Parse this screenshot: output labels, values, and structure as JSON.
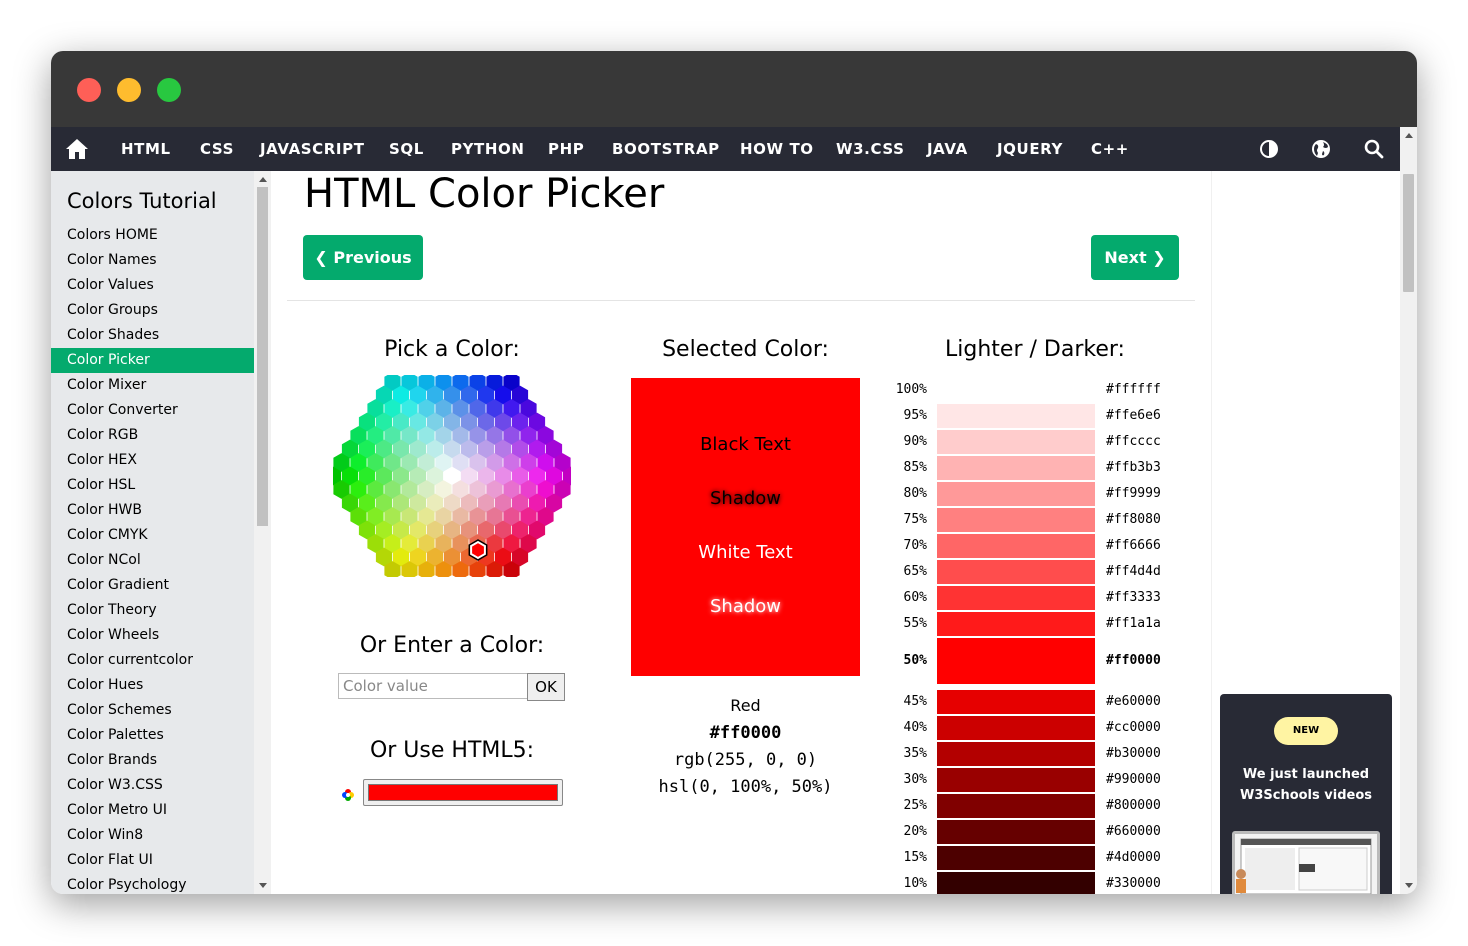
{
  "nav": {
    "items": [
      "HTML",
      "CSS",
      "JAVASCRIPT",
      "SQL",
      "PYTHON",
      "PHP",
      "BOOTSTRAP",
      "HOW TO",
      "W3.CSS",
      "JAVA",
      "JQUERY",
      "C++"
    ]
  },
  "sidebar": {
    "title": "Colors Tutorial",
    "items": [
      "Colors HOME",
      "Color Names",
      "Color Values",
      "Color Groups",
      "Color Shades",
      "Color Picker",
      "Color Mixer",
      "Color Converter",
      "Color RGB",
      "Color HEX",
      "Color HSL",
      "Color HWB",
      "Color CMYK",
      "Color NCol",
      "Color Gradient",
      "Color Theory",
      "Color Wheels",
      "Color currentcolor",
      "Color Hues",
      "Color Schemes",
      "Color Palettes",
      "Color Brands",
      "Color W3.CSS",
      "Color Metro UI",
      "Color Win8",
      "Color Flat UI",
      "Color Psychology"
    ],
    "active": "Color Picker"
  },
  "page": {
    "title": "HTML Color Picker",
    "prev_label": "Previous",
    "next_label": "Next"
  },
  "picker": {
    "pick_title": "Pick a Color:",
    "enter_title": "Or Enter a Color:",
    "input_placeholder": "Color value",
    "ok_label": "OK",
    "html5_title": "Or Use HTML5:",
    "html5_value": "#ff0000"
  },
  "selected": {
    "title": "Selected Color:",
    "color": "#ff0000",
    "black_text": "Black Text",
    "shadow1": "Shadow",
    "white_text": "White Text",
    "shadow2": "Shadow",
    "name": "Red",
    "hex": "#ff0000",
    "rgb": "rgb(255, 0, 0)",
    "hsl": "hsl(0, 100%, 50%)"
  },
  "shades": {
    "title": "Lighter / Darker:",
    "rows": [
      {
        "pct": "100%",
        "hex": "#ffffff"
      },
      {
        "pct": "95%",
        "hex": "#ffe6e6"
      },
      {
        "pct": "90%",
        "hex": "#ffcccc"
      },
      {
        "pct": "85%",
        "hex": "#ffb3b3"
      },
      {
        "pct": "80%",
        "hex": "#ff9999"
      },
      {
        "pct": "75%",
        "hex": "#ff8080"
      },
      {
        "pct": "70%",
        "hex": "#ff6666"
      },
      {
        "pct": "65%",
        "hex": "#ff4d4d"
      },
      {
        "pct": "60%",
        "hex": "#ff3333"
      },
      {
        "pct": "55%",
        "hex": "#ff1a1a"
      },
      {
        "pct": "50%",
        "hex": "#ff0000",
        "selected": true
      },
      {
        "pct": "45%",
        "hex": "#e60000"
      },
      {
        "pct": "40%",
        "hex": "#cc0000"
      },
      {
        "pct": "35%",
        "hex": "#b30000"
      },
      {
        "pct": "30%",
        "hex": "#990000"
      },
      {
        "pct": "25%",
        "hex": "#800000"
      },
      {
        "pct": "20%",
        "hex": "#660000"
      },
      {
        "pct": "15%",
        "hex": "#4d0000"
      },
      {
        "pct": "10%",
        "hex": "#330000"
      }
    ]
  },
  "ad": {
    "badge": "NEW",
    "line1": "We just launched",
    "line2": "W3Schools videos"
  },
  "colors": {
    "accent": "#04aa6d",
    "nav_bg": "#282a35",
    "titlebar": "#383838",
    "sidebar_bg": "#e7e9eb"
  }
}
